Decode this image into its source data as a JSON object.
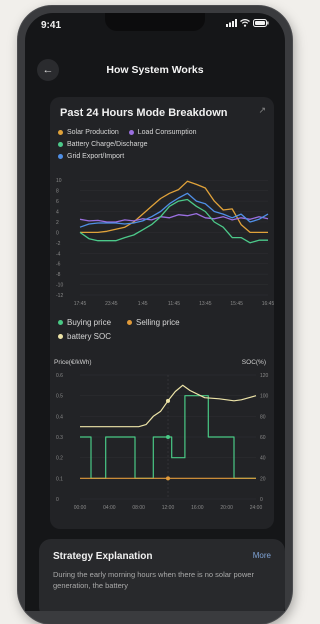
{
  "status_bar": {
    "time": "9:41"
  },
  "nav": {
    "title": "How System Works",
    "back_icon": "arrow-left-icon"
  },
  "colors": {
    "solar": "#e0a23a",
    "load": "#9a6fe0",
    "battery": "#4cc98a",
    "grid": "#4f8fe6",
    "buying": "#49c985",
    "selling": "#e09a3a",
    "soc": "#ede4a8"
  },
  "card": {
    "title": "Past 24 Hours Mode Breakdown",
    "legend1": {
      "solar": "Solar Production",
      "load": "Load Consumption",
      "battery": "Battery Charge/Discharge",
      "grid": "Grid Export/Import"
    },
    "legend2": {
      "buying": "Buying price",
      "selling": "Selling price",
      "soc": "battery SOC"
    },
    "chart2_left_label": "Price(€/kWh)",
    "chart2_right_label": "SOC(%)"
  },
  "chart_data": [
    {
      "type": "line",
      "title": "Past 24 Hours Mode Breakdown",
      "x": [
        "17:45",
        "23:45",
        "1:45",
        "11:45",
        "13:45",
        "15:45",
        "16:45"
      ],
      "yticks": [
        10,
        8,
        6,
        4,
        2,
        0,
        -2,
        -4,
        -6,
        -8,
        -10,
        -12
      ],
      "ylim": [
        -12,
        11
      ],
      "grid": true,
      "legend": "top",
      "series": [
        {
          "name": "Solar Production",
          "values": [
            0,
            0,
            0,
            0.2,
            0.6,
            1,
            2,
            3.5,
            5,
            6.5,
            7.5,
            8.2,
            9.8,
            9.2,
            8.5,
            6,
            4.3,
            4.5,
            1.5,
            0,
            0,
            0
          ]
        },
        {
          "name": "Load Consumption",
          "values": [
            2.5,
            2.2,
            2.3,
            2.0,
            2.0,
            2.4,
            2.2,
            2.6,
            2.4,
            3.0,
            2.8,
            3.4,
            3.2,
            3.6,
            2.8,
            2.6,
            3.0,
            2.4,
            2.8,
            2.5,
            3.0,
            2.6
          ]
        },
        {
          "name": "Battery Charge/Discharge",
          "values": [
            0,
            -1.2,
            -1.6,
            -1.6,
            -1.6,
            -1.0,
            -0.5,
            0.5,
            1.5,
            3,
            5,
            6,
            6.3,
            5,
            4,
            2,
            1,
            -1,
            -1,
            -2,
            -1.5,
            -1.5
          ]
        },
        {
          "name": "Grid Export/Import",
          "values": [
            1.0,
            1.6,
            1.8,
            1.8,
            1.8,
            1.6,
            1.8,
            2.2,
            3.0,
            4.0,
            5.5,
            6.6,
            7.5,
            6.0,
            5.5,
            4.0,
            3.5,
            2.8,
            3.5,
            2.0,
            2.5,
            3.5
          ]
        }
      ]
    },
    {
      "type": "line",
      "x": [
        "00:00",
        "04:00",
        "08:00",
        "12:00",
        "16:00",
        "20:00",
        "24:00"
      ],
      "yticks_left": [
        0.6,
        0.5,
        0.4,
        0.3,
        0.2,
        0.1,
        0
      ],
      "yticks_right": [
        120,
        100,
        80,
        60,
        40,
        20,
        0
      ],
      "ylim_left": [
        0,
        0.6
      ],
      "ylim_right": [
        0,
        120
      ],
      "grid": true,
      "legend": "top",
      "series": [
        {
          "name": "Buying price",
          "axis": "left",
          "step": true,
          "points": [
            [
              0,
              0.3
            ],
            [
              1.5,
              0.3
            ],
            [
              1.5,
              0.1
            ],
            [
              3.5,
              0.1
            ],
            [
              3.5,
              0.3
            ],
            [
              7.5,
              0.3
            ],
            [
              7.5,
              0.1
            ],
            [
              10,
              0.1
            ],
            [
              10,
              0.3
            ],
            [
              12.5,
              0.3
            ],
            [
              12.5,
              0.2
            ],
            [
              14.3,
              0.2
            ],
            [
              14.3,
              0.5
            ],
            [
              17.5,
              0.5
            ],
            [
              17.5,
              0.3
            ],
            [
              21,
              0.3
            ],
            [
              21,
              0.1
            ],
            [
              24,
              0.1
            ]
          ]
        },
        {
          "name": "Selling price",
          "axis": "left",
          "points": [
            [
              0,
              0.1
            ],
            [
              24,
              0.1
            ]
          ]
        },
        {
          "name": "battery SOC",
          "axis": "right",
          "points": [
            [
              0,
              70
            ],
            [
              4,
              70
            ],
            [
              6,
              70
            ],
            [
              8,
              70
            ],
            [
              9,
              72
            ],
            [
              10,
              80
            ],
            [
              11,
              85
            ],
            [
              12,
              95
            ],
            [
              13,
              104
            ],
            [
              14,
              110
            ],
            [
              15,
              105
            ],
            [
              17,
              98
            ],
            [
              19,
              97
            ],
            [
              21,
              95
            ],
            [
              22,
              96
            ],
            [
              24,
              100
            ]
          ]
        }
      ]
    }
  ],
  "strategy": {
    "title": "Strategy Explanation",
    "more": "More",
    "text": "During the early morning hours when there is no solar power generation, the battery"
  }
}
